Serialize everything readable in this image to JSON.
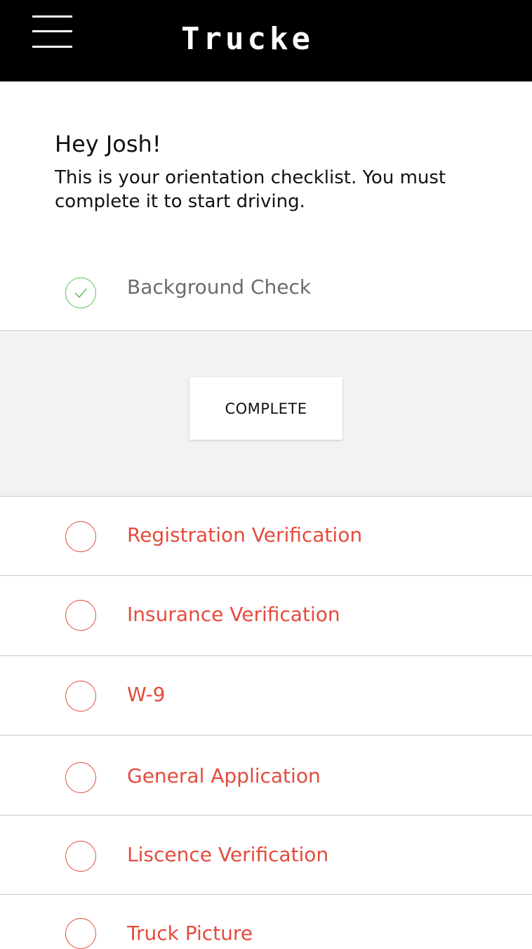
{
  "header": {
    "app_name": "Trucke",
    "menu_icon": "hamburger-menu-icon"
  },
  "greeting": {
    "title": "Hey Josh!",
    "message": "This is your orientation checklist. You must complete it to start driving."
  },
  "panel": {
    "complete_label": "COMPLETE"
  },
  "colors": {
    "header_bg": "#000000",
    "pending": "#e44b3c",
    "done_check": "#5bbf5b",
    "done_text": "#6b6b6b",
    "panel_bg": "#f2f2f2"
  },
  "checklist": [
    {
      "label": "Background Check",
      "status": "complete",
      "icon": "check-circle-icon"
    },
    {
      "label": "Registration Verification",
      "status": "pending",
      "icon": "empty-circle-icon"
    },
    {
      "label": "Insurance Verification",
      "status": "pending",
      "icon": "empty-circle-icon"
    },
    {
      "label": "W-9",
      "status": "pending",
      "icon": "empty-circle-icon"
    },
    {
      "label": "General Application",
      "status": "pending",
      "icon": "empty-circle-icon"
    },
    {
      "label": "Liscence Verification",
      "status": "pending",
      "icon": "empty-circle-icon"
    },
    {
      "label": "Truck Picture",
      "status": "pending",
      "icon": "empty-circle-icon"
    }
  ]
}
